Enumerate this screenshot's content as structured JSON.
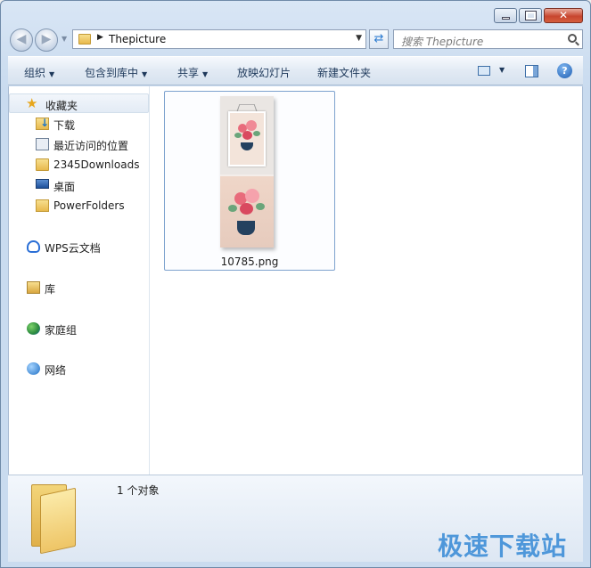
{
  "window": {
    "buttons": [
      "minimize",
      "maximize",
      "close"
    ]
  },
  "navbar": {
    "address_text": "Thepicture",
    "search_placeholder": "搜索 Thepicture"
  },
  "toolbar": {
    "organize": "组织",
    "include_in_library": "包含到库中",
    "share": "共享",
    "slideshow": "放映幻灯片",
    "new_folder": "新建文件夹"
  },
  "sidebar": {
    "favorites": "收藏夹",
    "items": [
      "下载",
      "最近访问的位置",
      "2345Downloads",
      "桌面",
      "PowerFolders"
    ],
    "wps_cloud": "WPS云文档",
    "libraries": "库",
    "homegroup": "家庭组",
    "network": "网络"
  },
  "files": [
    {
      "name": "10785.png",
      "icon": "image-thumbnail"
    }
  ],
  "details": {
    "count_text": "1 个对象"
  },
  "watermark": "极速下载站"
}
